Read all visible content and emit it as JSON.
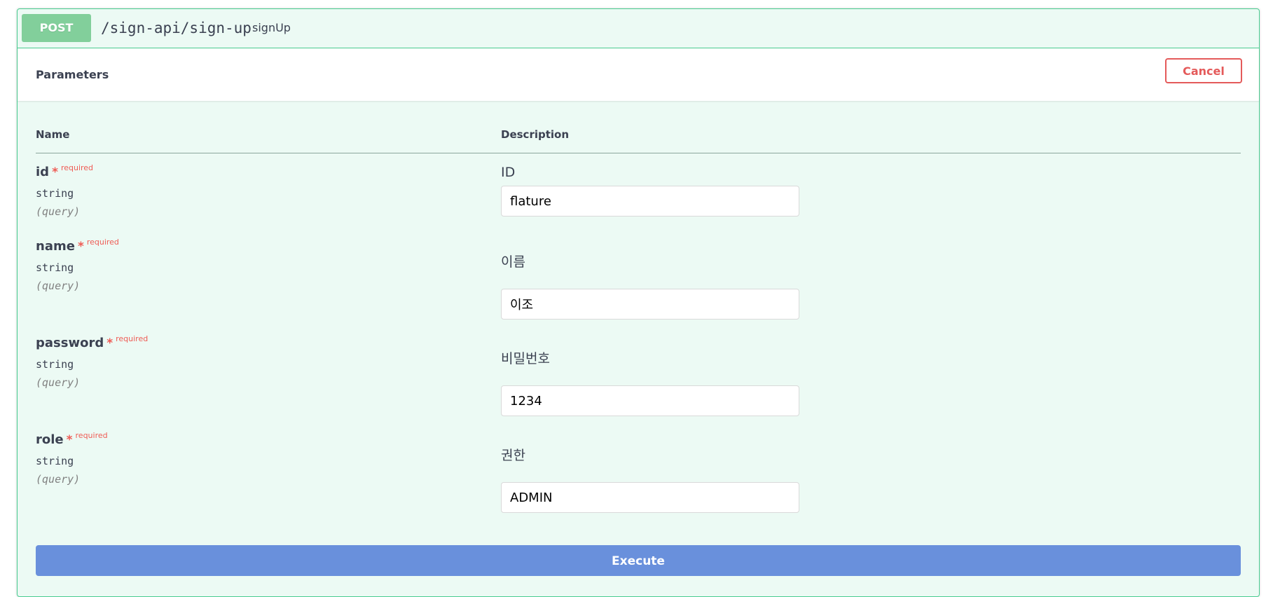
{
  "operation": {
    "method": "POST",
    "path": "/sign-api/sign-up",
    "operation_id": "signUp"
  },
  "parameters_section": {
    "title": "Parameters",
    "cancel_label": "Cancel",
    "column_name": "Name",
    "column_description": "Description"
  },
  "params": [
    {
      "name": "id",
      "star": "*",
      "required_label": "required",
      "type": "string",
      "in": "(query)",
      "description": "ID",
      "value": "flature"
    },
    {
      "name": "name",
      "star": "*",
      "required_label": "required",
      "type": "string",
      "in": "(query)",
      "description": "이름",
      "value": "이조"
    },
    {
      "name": "password",
      "star": "*",
      "required_label": "required",
      "type": "string",
      "in": "(query)",
      "description": "비밀번호",
      "value": "1234"
    },
    {
      "name": "role",
      "star": "*",
      "required_label": "required",
      "type": "string",
      "in": "(query)",
      "description": "권한",
      "value": "ADMIN"
    }
  ],
  "execute_label": "Execute",
  "colors": {
    "post_method": "#82cf9b",
    "block_border": "#49cc90",
    "cancel": "#e45a5a",
    "execute": "#6990dc",
    "required": "#ef5c55"
  }
}
